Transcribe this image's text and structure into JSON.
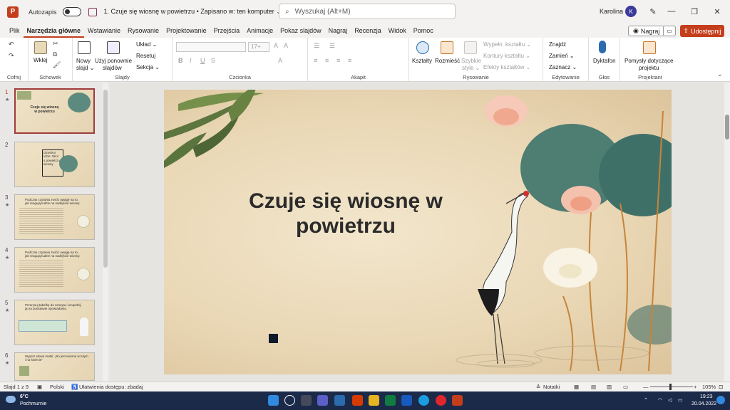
{
  "titlebar": {
    "app_letter": "P",
    "autosave_label": "Autozapis",
    "doc_title": "1. Czuje się wiosnę w powietrzu • Zapisano w: ten komputer ⌄",
    "search_placeholder": "Wyszukaj (Alt+M)",
    "user_name": "Karolina",
    "user_initial": "K"
  },
  "menu": {
    "tabs": [
      "Plik",
      "Narzędzia główne",
      "Wstawianie",
      "Rysowanie",
      "Projektowanie",
      "Przejścia",
      "Animacje",
      "Pokaz slajdów",
      "Nagraj",
      "Recenzja",
      "Widok",
      "Pomoc"
    ],
    "record_label": "Nagraj",
    "share_label": "Udostępnij"
  },
  "ribbon": {
    "undo_group": "Cofnij",
    "paste": "Wklej",
    "clipboard_group": "Schowek",
    "new_slide_1": "Nowy",
    "new_slide_2": "slajd ⌄",
    "reuse_1": "Użyj ponownie",
    "reuse_2": "slajdów",
    "layout": "Układ ⌄",
    "reset": "Resetuj",
    "section": "Sekcja ⌄",
    "slides_group": "Slajdy",
    "font_size": "17+",
    "font_group": "Czcionka",
    "paragraph_group": "Akapit",
    "shapes": "Kształty",
    "arrange": "Rozmieść",
    "quick_styles_1": "Szybkie",
    "quick_styles_2": "style ⌄",
    "shape_fill": "Wypełn. kształtu ⌄",
    "shape_outline": "Kontury kształtu ⌄",
    "shape_effects": "Efekty kształtów ⌄",
    "drawing_group": "Rysowanie",
    "find": "Znajdź",
    "replace": "Zamień ⌄",
    "select": "Zaznacz ⌄",
    "editing_group": "Edytowanie",
    "dictate": "Dyktafon",
    "voice_group": "Głos",
    "designer_1": "Pomysły dotyczące",
    "designer_2": "projektu",
    "designer_group": "Projektant"
  },
  "thumbnails": [
    {
      "num": "1",
      "text": "Czuje się wiosnę w powietrzu"
    },
    {
      "num": "2",
      "text": "Dziecko! Idzie: Wiol s powietrzu wiosny"
    },
    {
      "num": "3",
      "text": "Podczas czytania zwróć uwagę na to, jak reagują ludzie na nadejście wiosny."
    },
    {
      "num": "4",
      "text": "Podczas czytania zwróć uwagę na to, jak reagują ludzie na nadejście wiosny."
    },
    {
      "num": "5",
      "text": "Przerysuj tabelkę do zeszytu i uzupełnij ją na podstawie opowiadania."
    },
    {
      "num": "6",
      "text": "Wypisz słowa matki: „Bo jest wiosna w lutym i na świecie\""
    }
  ],
  "slide": {
    "title_line1": "Czuje się wiosnę w",
    "title_line2": "powietrzu"
  },
  "statusbar": {
    "slide_count": "Slajd 1 z 9",
    "language": "Polski",
    "accessibility": "Ułatwienia dostępu: zbadaj",
    "notes": "Notatki",
    "zoom": "105%"
  },
  "taskbar": {
    "temp": "6°C",
    "weather": "Pochmurnie",
    "time": "19:23",
    "date": "20.04.2022"
  },
  "colors": {
    "accent": "#c43e1c",
    "title_text": "#2b2b2b",
    "taskbar": "#1c2a4a"
  }
}
